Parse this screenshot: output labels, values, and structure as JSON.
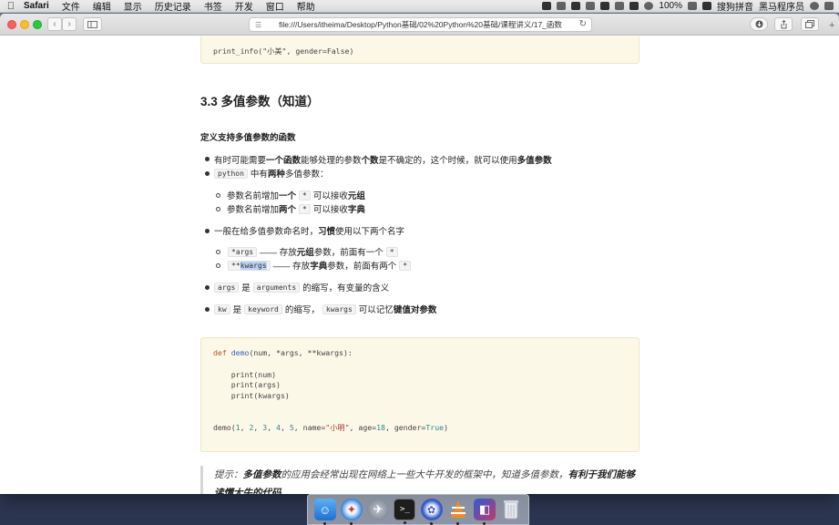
{
  "menubar": {
    "apple": "",
    "app_name": "Safari",
    "items": [
      "文件",
      "编辑",
      "显示",
      "历史记录",
      "书签",
      "开发",
      "窗口",
      "帮助"
    ],
    "battery": "100%",
    "input_method": "搜狗拼音",
    "user": "黑马程序员"
  },
  "browser": {
    "url": "file:///Users/itheima/Desktop/Python基础/02%20Python%20基础/课程讲义/17_函数",
    "back_icon": "‹",
    "forward_icon": "›"
  },
  "doc": {
    "code_top": "print_info(\"小美\", gender=False)",
    "section_title": "3.3 多值参数（知道）",
    "subheading": "定义支持多值参数的函数",
    "b1": {
      "t1": "有时可能需要",
      "b1": "一个函数",
      "t2": "能够处理的参数",
      "b2": "个数",
      "t3": "是不确定的，这个时候，就可以使用",
      "b3": "多值参数"
    },
    "b2": {
      "code": "python",
      "t1": "中有",
      "b1": "两种",
      "t2": "多值参数："
    },
    "b2_sub1": {
      "t1": "参数名前增加",
      "b1": "一个",
      "code": "*",
      "t2": "可以接收",
      "b2": "元组"
    },
    "b2_sub2": {
      "t1": "参数名前增加",
      "b1": "两个",
      "code": "*",
      "t2": "可以接收",
      "b2": "字典"
    },
    "b3": {
      "t1": "一般在给多值参数命名时，",
      "b1": "习惯",
      "t2": "使用以下两个名字"
    },
    "b3_sub1": {
      "code": "*args",
      "t1": "—— 存放",
      "b1": "元组",
      "t2": "参数，前面有一个",
      "code2": "*"
    },
    "b3_sub2": {
      "code_a": "**",
      "code_b": "kwargs",
      "t1": "—— 存放",
      "b1": "字典",
      "t2": "参数，前面有两个",
      "code2": "*"
    },
    "b4": {
      "code": "args",
      "t1": "是",
      "code2": "arguments",
      "t2": "的缩写，有变量的含义"
    },
    "b5": {
      "code": "kw",
      "t1": "是",
      "code2": "keyword",
      "t2": "的缩写，",
      "code3": "kwargs",
      "t3": "可以记忆",
      "b1": "键值对参数"
    },
    "code": {
      "l1_kw": "def",
      "l1_fn": "demo",
      "l1_rest": "(num, *args, **kwargs):",
      "l2": "    print(num)",
      "l3": "    print(args)",
      "l4": "    print(kwargs)",
      "l5_pre": "demo(",
      "n1": "1",
      "n2": "2",
      "n3": "3",
      "n4": "4",
      "n5": "5",
      "l5_name": ", name=",
      "l5_str": "\"小明\"",
      "l5_age": ", age=",
      "n6": "18",
      "l5_gender": ", gender=",
      "l5_bool": "True",
      "l5_end": ")"
    },
    "tip": {
      "t1": "提示：",
      "b1": "多值参数",
      "t2": "的应用会经常出现在网络上一些大牛开发的框架中，知道多值参数，",
      "b2": "有利于我们能够读懂大牛的代码"
    }
  },
  "dock": {
    "items": [
      "finder-icon",
      "safari-icon",
      "launchpad-icon",
      "terminal-icon",
      "app-icon",
      "vlc-icon",
      "app2-icon",
      "trash-icon"
    ]
  }
}
